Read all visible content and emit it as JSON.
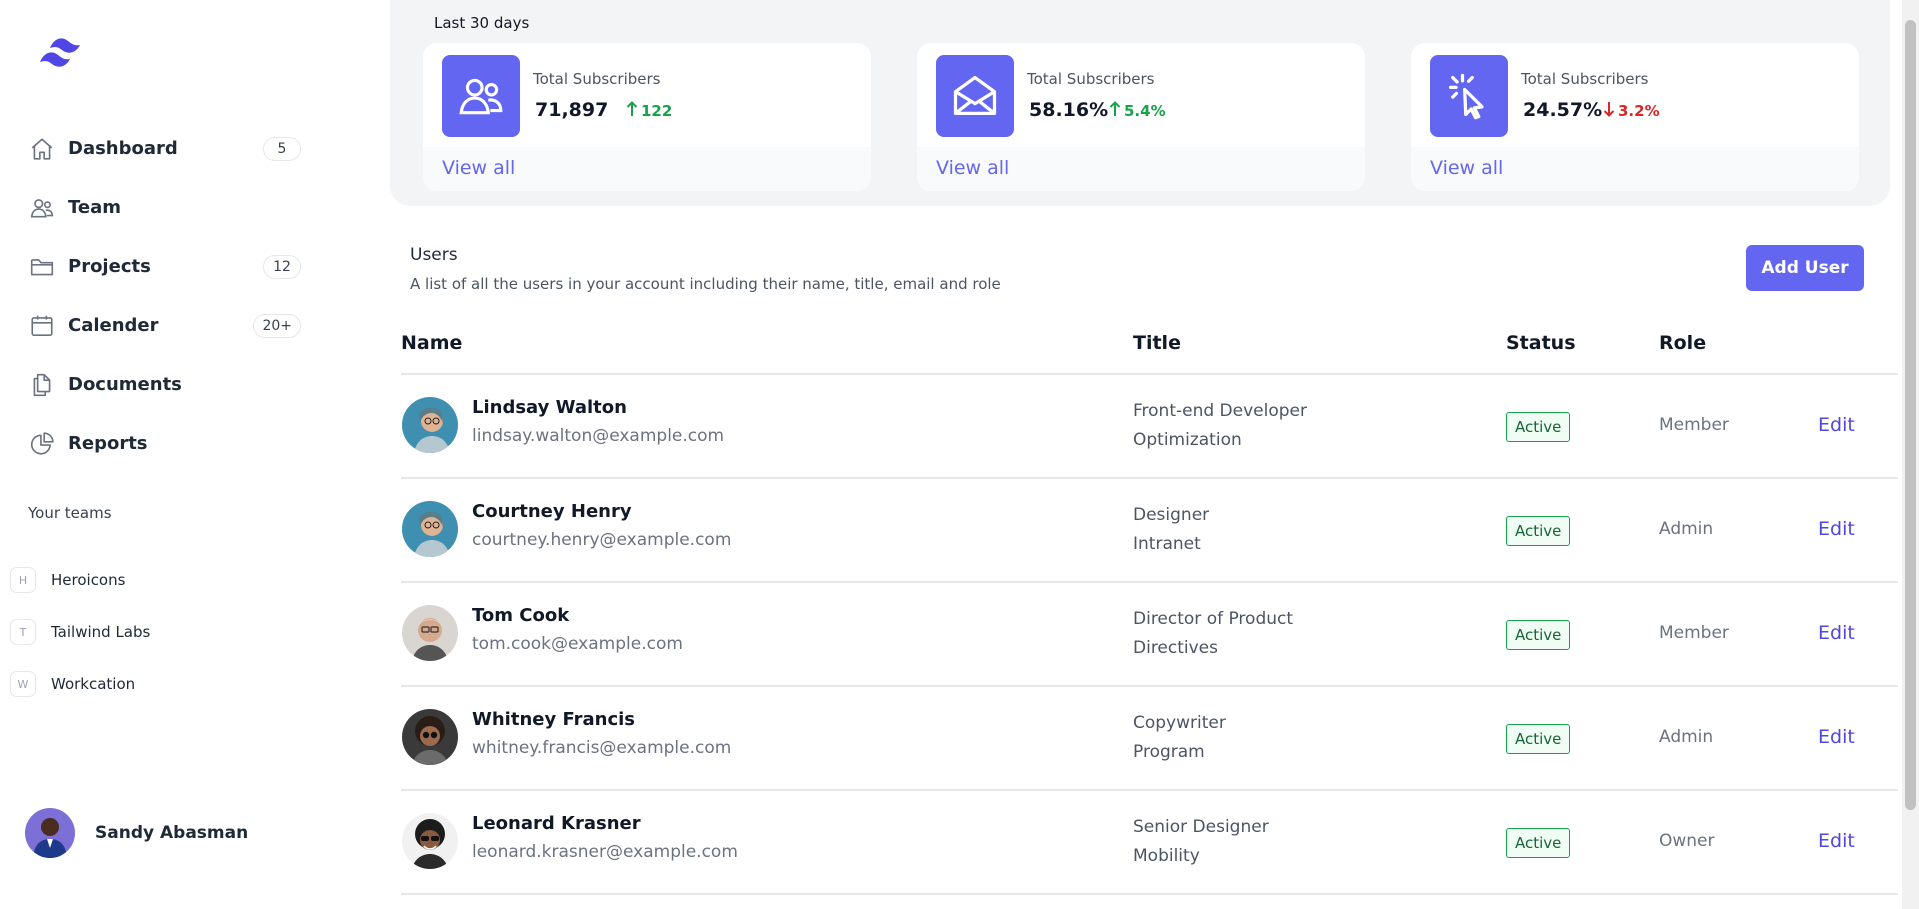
{
  "sidebar": {
    "nav": [
      {
        "label": "Dashboard",
        "count": "5",
        "icon": "home-icon"
      },
      {
        "label": "Team",
        "count": null,
        "icon": "users-icon"
      },
      {
        "label": "Projects",
        "count": "12",
        "icon": "folder-icon"
      },
      {
        "label": "Calender",
        "count": "20+",
        "icon": "calendar-icon"
      },
      {
        "label": "Documents",
        "count": null,
        "icon": "documents-icon"
      },
      {
        "label": "Reports",
        "count": null,
        "icon": "pie-chart-icon"
      }
    ],
    "teams_heading": "Your teams",
    "teams": [
      {
        "initial": "H",
        "name": "Heroicons"
      },
      {
        "initial": "T",
        "name": "Tailwind Labs"
      },
      {
        "initial": "W",
        "name": "Workcation"
      }
    ],
    "profile": {
      "name": "Sandy Abasman"
    }
  },
  "stats": {
    "period": "Last 30 days",
    "cards": [
      {
        "label": "Total Subscribers",
        "value": "71,897",
        "change": "122",
        "direction": "up",
        "link": "View all",
        "icon": "users-icon"
      },
      {
        "label": "Total Subscribers",
        "value": "58.16%",
        "change": "5.4%",
        "direction": "up",
        "link": "View all",
        "icon": "envelope-open-icon"
      },
      {
        "label": "Total Subscribers",
        "value": "24.57%",
        "change": "3.2%",
        "direction": "down",
        "link": "View all",
        "icon": "cursor-click-icon"
      }
    ]
  },
  "users": {
    "title": "Users",
    "description": "A list of all the users in your account including their name, title, email and role",
    "add_button": "Add User",
    "columns": {
      "name": "Name",
      "title": "Title",
      "status": "Status",
      "role": "Role"
    },
    "rows": [
      {
        "name": "Lindsay Walton",
        "email": "lindsay.walton@example.com",
        "title": "Front-end Developer",
        "department": "Optimization",
        "status": "Active",
        "role": "Member",
        "action": "Edit"
      },
      {
        "name": "Courtney Henry",
        "email": "courtney.henry@example.com",
        "title": "Designer",
        "department": "Intranet",
        "status": "Active",
        "role": "Admin",
        "action": "Edit"
      },
      {
        "name": "Tom Cook",
        "email": "tom.cook@example.com",
        "title": "Director of Product",
        "department": "Directives",
        "status": "Active",
        "role": "Member",
        "action": "Edit"
      },
      {
        "name": "Whitney Francis",
        "email": "whitney.francis@example.com",
        "title": "Copywriter",
        "department": "Program",
        "status": "Active",
        "role": "Admin",
        "action": "Edit"
      },
      {
        "name": "Leonard Krasner",
        "email": "leonard.krasner@example.com",
        "title": "Senior Designer",
        "department": "Mobility",
        "status": "Active",
        "role": "Owner",
        "action": "Edit"
      }
    ]
  },
  "colors": {
    "accent": "#6366f1",
    "success": "#16a34a",
    "danger": "#dc2626"
  }
}
